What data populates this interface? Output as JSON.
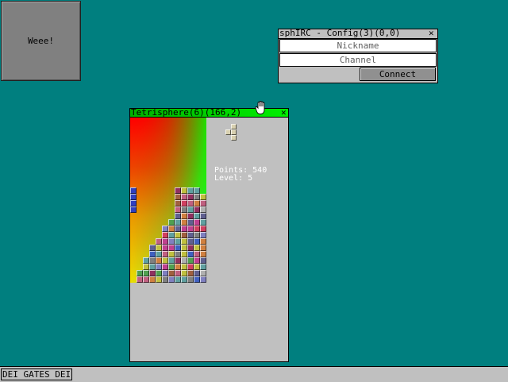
{
  "desktop": {
    "background": "#007f7f",
    "box_label": "Weee!"
  },
  "irc_window": {
    "title": "sphIRC - Config(3)(0,0)",
    "close_glyph": "✕",
    "nickname_placeholder": "Nickname",
    "channel_placeholder": "Channel",
    "connect_label": "Connect"
  },
  "tetris_window": {
    "title": "Tetrisphere(6)(166,2)",
    "close_glyph": "✕",
    "points_text": "Points: 540",
    "level_text": "Level: 5",
    "next_piece": "T"
  },
  "cursor": {
    "icon": "hand-cursor-icon"
  },
  "taskbar": {
    "button_label": "DEI GATES DEI"
  }
}
